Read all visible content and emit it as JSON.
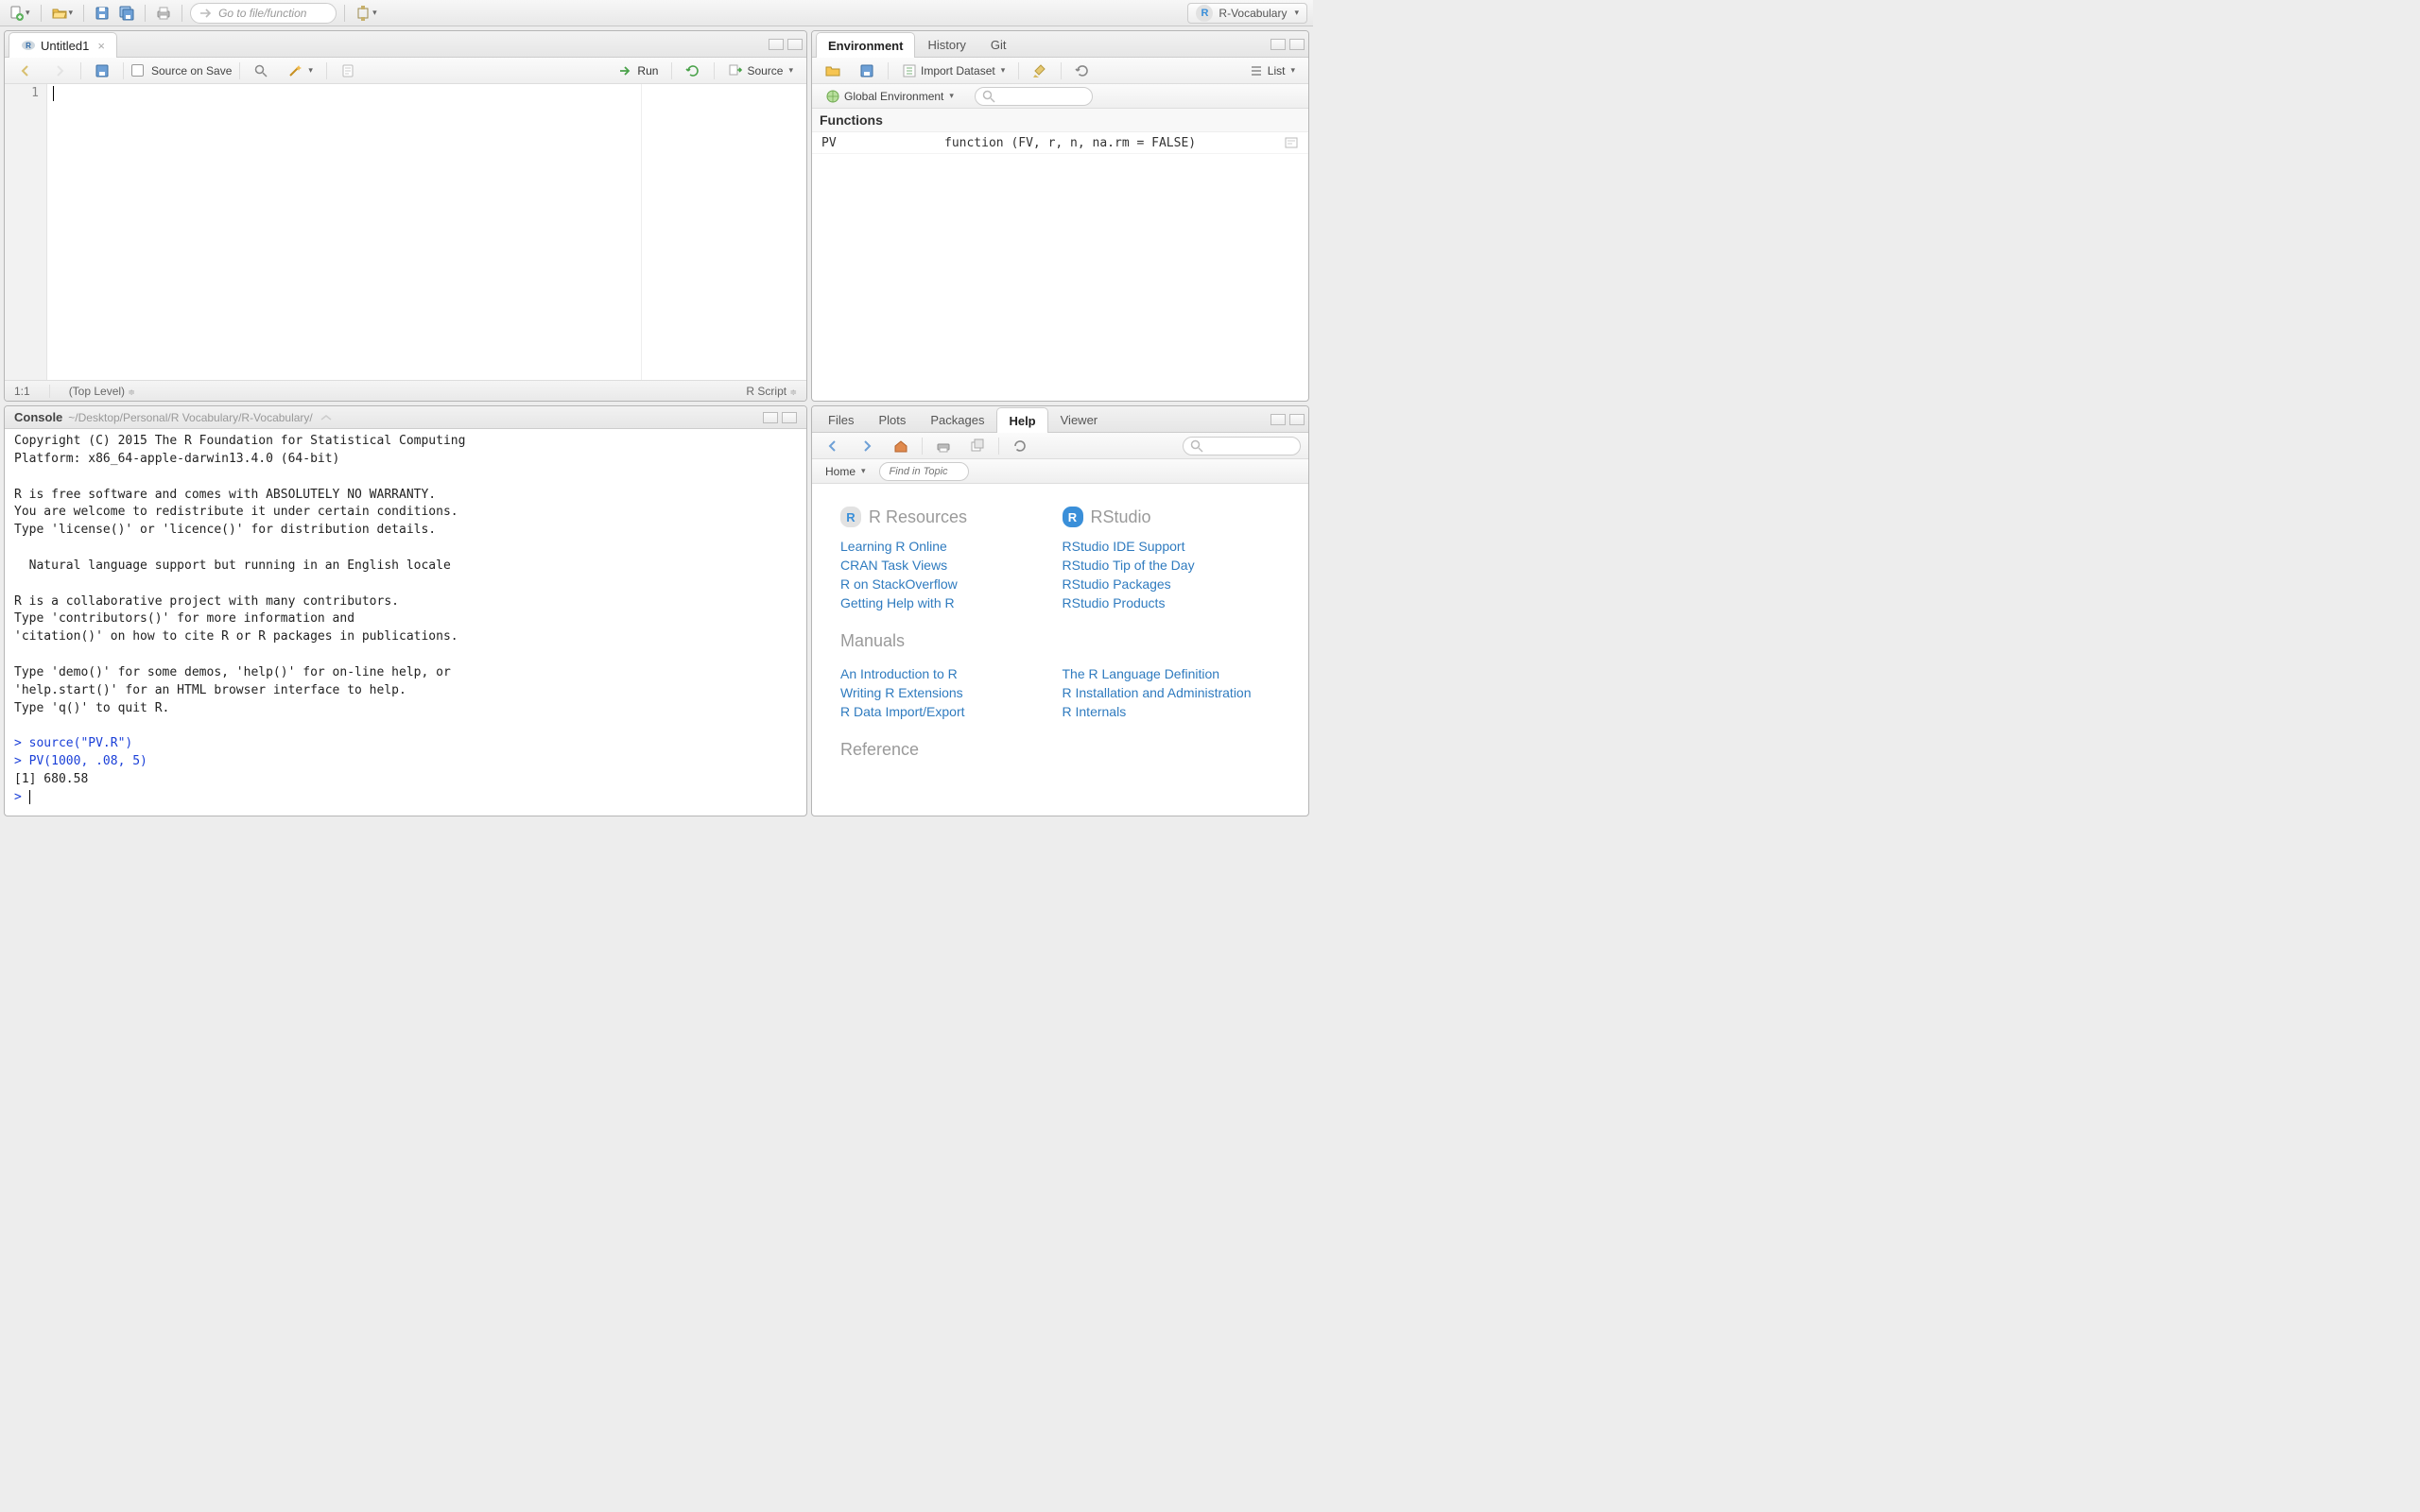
{
  "toolbar": {
    "goto_placeholder": "Go to file/function",
    "project_name": "R-Vocabulary"
  },
  "source": {
    "tab_title": "Untitled1",
    "source_on_save_label": "Source on Save",
    "run_label": "Run",
    "source_label": "Source",
    "line_number": "1",
    "cursor_pos": "1:1",
    "scope": "(Top Level)",
    "file_type": "R Script"
  },
  "console": {
    "title": "Console",
    "path": "~/Desktop/Personal/R Vocabulary/R-Vocabulary/",
    "line_copyright": "Copyright (C) 2015 The R Foundation for Statistical Computing",
    "line_platform": "Platform: x86_64-apple-darwin13.4.0 (64-bit)",
    "line_warranty1": "R is free software and comes with ABSOLUTELY NO WARRANTY.",
    "line_warranty2": "You are welcome to redistribute it under certain conditions.",
    "line_warranty3": "Type 'license()' or 'licence()' for distribution details.",
    "line_locale": "  Natural language support but running in an English locale",
    "line_collab1": "R is a collaborative project with many contributors.",
    "line_collab2": "Type 'contributors()' for more information and",
    "line_collab3": "'citation()' on how to cite R or R packages in publications.",
    "line_help1": "Type 'demo()' for some demos, 'help()' for on-line help, or",
    "line_help2": "'help.start()' for an HTML browser interface to help.",
    "line_help3": "Type 'q()' to quit R.",
    "cmd1": "source(\"PV.R\")",
    "cmd2": "PV(1000, .08, 5)",
    "out1": "[1] 680.58",
    "prompt": "> "
  },
  "environment": {
    "tab_env": "Environment",
    "tab_history": "History",
    "tab_git": "Git",
    "import_label": "Import Dataset",
    "list_label": "List",
    "scope": "Global Environment",
    "section_functions": "Functions",
    "fn_name": "PV",
    "fn_sig": "function (FV, r, n, na.rm = FALSE)"
  },
  "help_pane": {
    "tab_files": "Files",
    "tab_plots": "Plots",
    "tab_packages": "Packages",
    "tab_help": "Help",
    "tab_viewer": "Viewer",
    "home_label": "Home",
    "find_placeholder": "Find in Topic",
    "h_resources": "R Resources",
    "h_rstudio": "RStudio",
    "h_manuals": "Manuals",
    "h_reference": "Reference",
    "links_r": [
      "Learning R Online",
      "CRAN Task Views",
      "R on StackOverflow",
      "Getting Help with R"
    ],
    "links_rstudio": [
      "RStudio IDE Support",
      "RStudio Tip of the Day",
      "RStudio Packages",
      "RStudio Products"
    ],
    "links_man_l": [
      "An Introduction to R",
      "Writing R Extensions",
      "R Data Import/Export"
    ],
    "links_man_r": [
      "The R Language Definition",
      "R Installation and Administration",
      "R Internals"
    ]
  }
}
